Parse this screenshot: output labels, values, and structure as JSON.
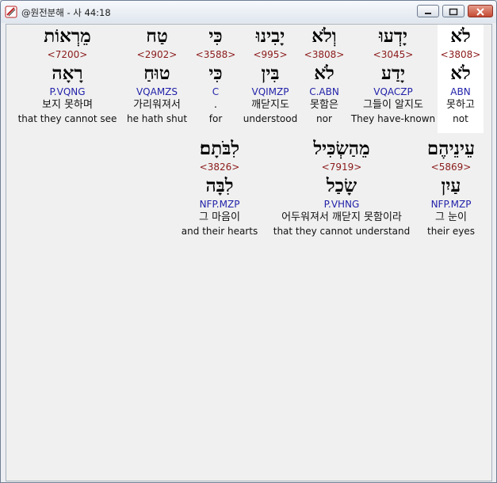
{
  "window": {
    "title": "@원전분해 - 사 44:18"
  },
  "words": [
    {
      "heb": "לֹא",
      "strong": "<3808>",
      "lemma": "לֹא",
      "morph": "ABN",
      "kor": "못하고",
      "eng": "not"
    },
    {
      "heb": "יָדְעוּ",
      "strong": "<3045>",
      "lemma": "יָדַע",
      "morph": "VQACZP",
      "kor": "그들이 알지도",
      "eng": "They have-known"
    },
    {
      "heb": "וְלֹא",
      "strong": "<3808>",
      "lemma": "לֹא",
      "morph": "C.ABN",
      "kor": "못함은",
      "eng": "nor"
    },
    {
      "heb": "יָבִינוּ",
      "strong": "<995>",
      "lemma": "בִּין",
      "morph": "VQIMZP",
      "kor": "깨닫지도",
      "eng": "understood"
    },
    {
      "heb": "כִּי",
      "strong": "<3588>",
      "lemma": "כִּי",
      "morph": "C",
      "kor": ".",
      "eng": "for"
    },
    {
      "heb": "טַח",
      "strong": "<2902>",
      "lemma": "טוּחַ",
      "morph": "VQAMZS",
      "kor": "가리워져서",
      "eng": "he hath shut"
    },
    {
      "heb": "מֵרְאוֹת",
      "strong": "<7200>",
      "lemma": "רָאָה",
      "morph": "P.VQNG",
      "kor": "보지 못하며",
      "eng": "that they cannot see"
    },
    {
      "heb": "עֵינֵיהֶם",
      "strong": "<5869>",
      "lemma": "עַיִן",
      "morph": "NFP.MZP",
      "kor": "그 눈이",
      "eng": "their eyes"
    },
    {
      "heb": "מֵהַשְׂכִּיל",
      "strong": "<7919>",
      "lemma": "שָׂכַל",
      "morph": "P.VHNG",
      "kor": "어두워져서 깨닫지 못함이라",
      "eng": "that they cannot understand"
    },
    {
      "heb": "לִבֹּתָם׃",
      "strong": "<3826>",
      "lemma": "לִבָּה",
      "morph": "NFP.MZP",
      "kor": "그 마음이",
      "eng": "and their hearts"
    }
  ]
}
